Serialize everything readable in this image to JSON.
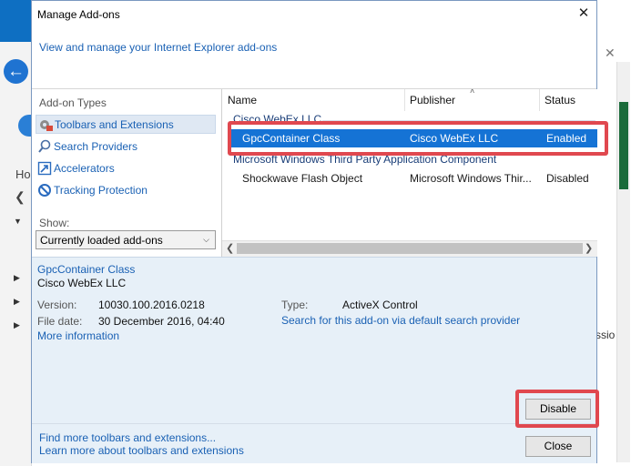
{
  "dialog": {
    "title": "Manage Add-ons",
    "header_link": "View and manage your Internet Explorer add-ons"
  },
  "addon_types": {
    "label": "Add-on Types",
    "items": [
      {
        "label": "Toolbars and Extensions",
        "icon": "gear-toolbar-icon",
        "selected": true
      },
      {
        "label": "Search Providers",
        "icon": "search-icon",
        "selected": false
      },
      {
        "label": "Accelerators",
        "icon": "accelerator-icon",
        "selected": false
      },
      {
        "label": "Tracking Protection",
        "icon": "no-entry-icon",
        "selected": false
      }
    ]
  },
  "show": {
    "label": "Show:",
    "selected": "Currently loaded add-ons"
  },
  "list": {
    "columns": [
      "Name",
      "Publisher",
      "Status"
    ],
    "groups": [
      {
        "header": "Cisco WebEx LLC",
        "rows": [
          {
            "name": "GpcContainer Class",
            "publisher": "Cisco WebEx LLC",
            "status": "Enabled",
            "selected": true
          }
        ]
      },
      {
        "header": "Microsoft Windows Third Party Application Component",
        "rows": [
          {
            "name": "Shockwave Flash Object",
            "publisher": "Microsoft Windows Thir...",
            "status": "Disabled",
            "selected": false
          }
        ]
      }
    ]
  },
  "details": {
    "addon_name": "GpcContainer Class",
    "publisher": "Cisco WebEx LLC",
    "version_label": "Version:",
    "version": "10030.100.2016.0218",
    "file_date_label": "File date:",
    "file_date": "30 December 2016, 04:40",
    "type_label": "Type:",
    "type": "ActiveX Control",
    "search_link": "Search for this add-on via default search provider",
    "more_info": "More information"
  },
  "buttons": {
    "disable": "Disable",
    "close": "Close"
  },
  "footer": {
    "find_more": "Find more toolbars and extensions...",
    "learn_more": "Learn more about toolbars and extensions"
  },
  "background": {
    "ho": "Ho",
    "ssio": "ssio"
  },
  "colors": {
    "accent": "#1573d5",
    "link": "#1a61b4",
    "highlight": "#e0484f"
  }
}
